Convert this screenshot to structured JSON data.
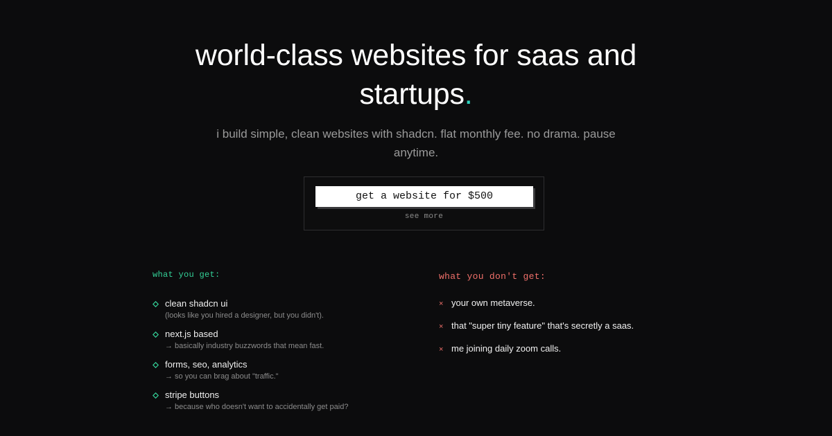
{
  "hero": {
    "headline": "world-class websites for saas and startups",
    "headline_dot": ".",
    "subhead": "i build simple, clean websites with shadcn. flat monthly fee. no drama. pause anytime."
  },
  "cta": {
    "button_label": "get a website for $500",
    "see_more_label": "see more"
  },
  "what_you_get": {
    "title": "what you get:",
    "items": [
      {
        "title": "clean shadcn ui",
        "desc": "(looks like you hired a designer, but you didn't)."
      },
      {
        "title": "next.js based",
        "desc": "→ basically industry buzzwords that mean fast."
      },
      {
        "title": "forms, seo, analytics",
        "desc": "→ so you can brag about \"traffic.\""
      },
      {
        "title": "stripe buttons",
        "desc": "→ because who doesn't want to accidentally get paid?"
      }
    ]
  },
  "what_you_dont_get": {
    "title": "what you don't get:",
    "bullet": "×",
    "items": [
      "your own metaverse.",
      "that \"super tiny feature\" that's secretly a saas.",
      "me joining daily zoom calls."
    ]
  },
  "colors": {
    "background": "#0c0c0d",
    "accent_green": "#34d399",
    "accent_teal": "#2dd4bf",
    "accent_red": "#f0706a"
  },
  "icons": {
    "get_bullet": "diamond-icon",
    "dont_bullet": "x-icon"
  }
}
